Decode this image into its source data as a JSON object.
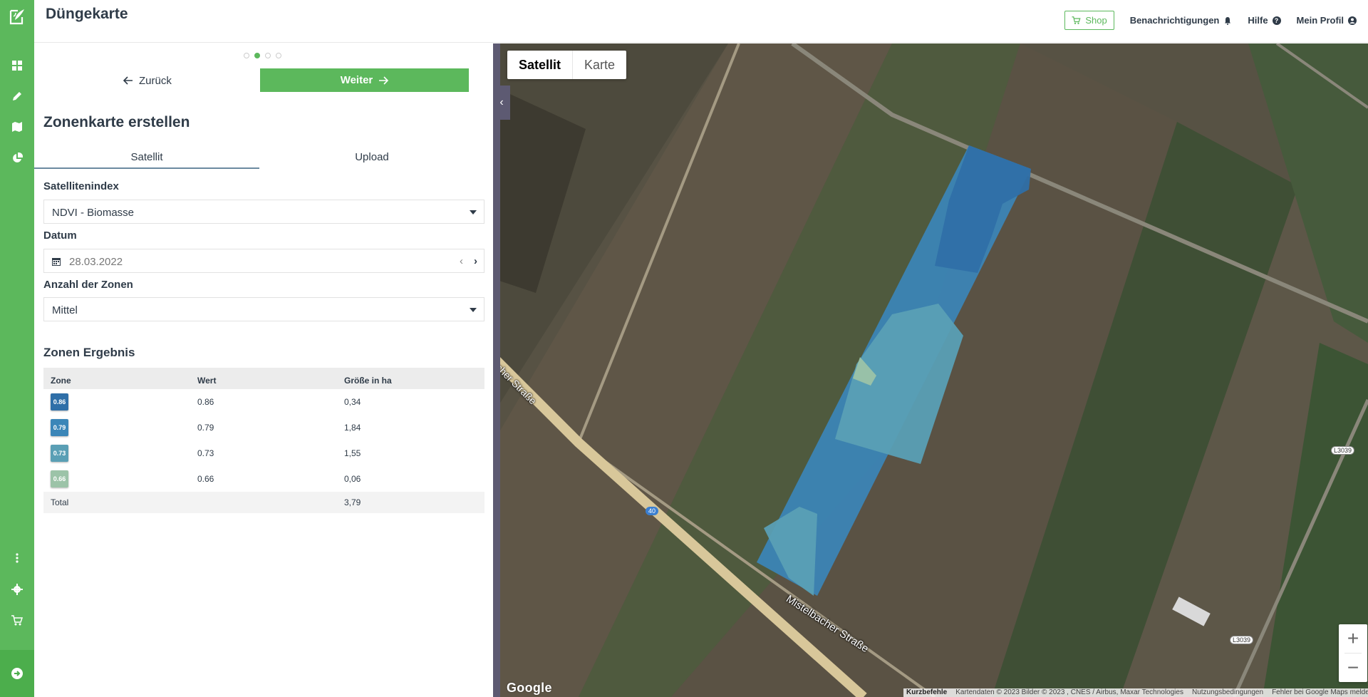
{
  "header": {
    "title": "Düngekarte",
    "shop": "Shop",
    "notifications": "Benachrichtigungen",
    "help": "Hilfe",
    "profile": "Mein Profil"
  },
  "steps": {
    "count": 4,
    "active": 2
  },
  "actions": {
    "back": "Zurück",
    "next": "Weiter"
  },
  "panel": {
    "title": "Zonenkarte erstellen",
    "tabs": [
      {
        "label": "Satellit",
        "active": true
      },
      {
        "label": "Upload",
        "active": false
      }
    ],
    "index_label": "Satellitenindex",
    "index_value": "NDVI - Biomasse",
    "date_label": "Datum",
    "date_value": "28.03.2022",
    "zones_label": "Anzahl der Zonen",
    "zones_value": "Mittel"
  },
  "results": {
    "title": "Zonen Ergebnis",
    "columns": [
      "Zone",
      "Wert",
      "Größe in ha"
    ],
    "rows": [
      {
        "badge": "0.86",
        "color": "#2f6fa8",
        "value": "0.86",
        "size": "0,34"
      },
      {
        "badge": "0.79",
        "color": "#3b86b8",
        "value": "0.79",
        "size": "1,84"
      },
      {
        "badge": "0.73",
        "color": "#5a9fb5",
        "value": "0.73",
        "size": "1,55"
      },
      {
        "badge": "0.66",
        "color": "#9cc3a8",
        "value": "0.66",
        "size": "0,06"
      }
    ],
    "total_label": "Total",
    "total_size": "3,79"
  },
  "map": {
    "types": [
      {
        "label": "Satellit",
        "active": true
      },
      {
        "label": "Karte",
        "active": false
      }
    ],
    "road_label_1": "Mistelbacher Straße",
    "road_label_2": "cher Straße",
    "shield_1": "L3039",
    "shield_2": "L3039",
    "shield_3": "40",
    "google": "Google",
    "attribution": {
      "shortcuts": "Kurzbefehle",
      "data": "Kartendaten © 2023 Bilder © 2023 , CNES / Airbus, Maxar Technologies",
      "terms": "Nutzungsbedingungen",
      "report": "Fehler bei Google Maps melden"
    }
  },
  "colors": {
    "brand": "#5cb85c",
    "text": "#2f3b48"
  }
}
